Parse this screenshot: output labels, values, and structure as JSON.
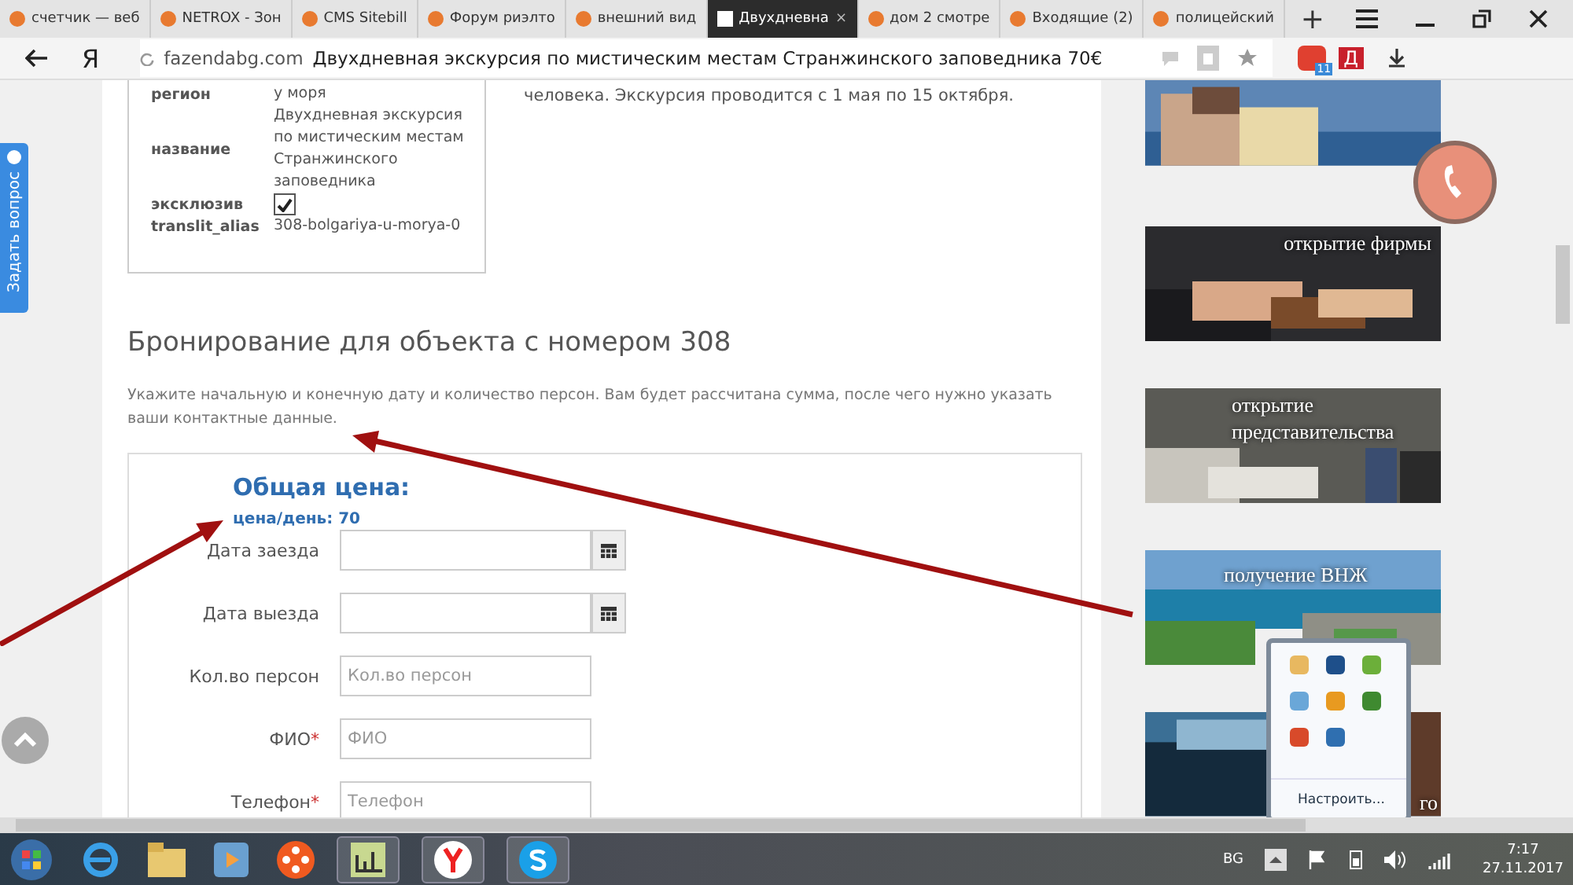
{
  "browser": {
    "tabs": [
      {
        "label": "счетчик — веб",
        "selected": false
      },
      {
        "label": "NETROX - Зон",
        "selected": false
      },
      {
        "label": "CMS Sitebill",
        "selected": false
      },
      {
        "label": "Форум риэлто",
        "selected": false
      },
      {
        "label": "внешний вид",
        "selected": false
      },
      {
        "label": "Двухдневна",
        "selected": true
      },
      {
        "label": "дом 2 смотре",
        "selected": false
      },
      {
        "label": "Входящие (2)",
        "selected": false
      },
      {
        "label": "полицейский",
        "selected": false
      }
    ],
    "close_tab": "×",
    "new_tab": "+",
    "yandex_button": "Я",
    "domain": "fazendabg.com",
    "page_title": "Двухдневная экскурсия по мистическим местам Странжинского заповедника 70€",
    "extension_badge": "11",
    "extension_letter": "Д"
  },
  "side_tab": "Задать вопрос",
  "property": [
    {
      "label": "регион",
      "value": "у моря",
      "kind": "text"
    },
    {
      "label": "название",
      "value": "Двухдневная экскурсия по мистическим местам Странжинского заповедника",
      "kind": "text"
    },
    {
      "label": "эксклюзив",
      "checked": true,
      "kind": "checkbox"
    },
    {
      "label": "translit_alias",
      "value": "308-bolgariya-u-morya-0",
      "kind": "text"
    }
  ],
  "description_tail": "человека. Экскурсия проводится с 1 мая по 15 октября.",
  "booking": {
    "heading": "Бронирование для объекта с номером 308",
    "intro": "Укажите начальную и конечную дату и количество персон. Вам будет рассчитана сумма, после чего нужно указать ваши контактные данные.",
    "total_title": "Общая цена:",
    "price_per_day": "цена/день: 70",
    "fields": [
      {
        "label": "Дата заезда",
        "kind": "date",
        "required": false
      },
      {
        "label": "Дата выезда",
        "kind": "date",
        "required": false
      },
      {
        "label": "Кол.во персон",
        "kind": "text",
        "placeholder": "Кол.во персон",
        "required": false
      },
      {
        "label": "ФИО",
        "kind": "text",
        "placeholder": "ФИО",
        "required": true
      },
      {
        "label": "Телефон",
        "kind": "text",
        "placeholder": "Телефон",
        "required": true
      }
    ],
    "required_mark": "*"
  },
  "banners": [
    {
      "kind": "picture"
    },
    {
      "kind": "picture",
      "caption": "открытие фирмы"
    },
    {
      "kind": "picture",
      "caption": "открытие представительства"
    },
    {
      "kind": "picture",
      "caption": "получение ВНЖ"
    },
    {
      "kind": "picture",
      "caption": "го"
    }
  ],
  "tray_popup": {
    "customize_link": "Настроить..."
  },
  "taskbar": {
    "language": "BG",
    "time": "7:17",
    "date": "27.11.2017"
  }
}
